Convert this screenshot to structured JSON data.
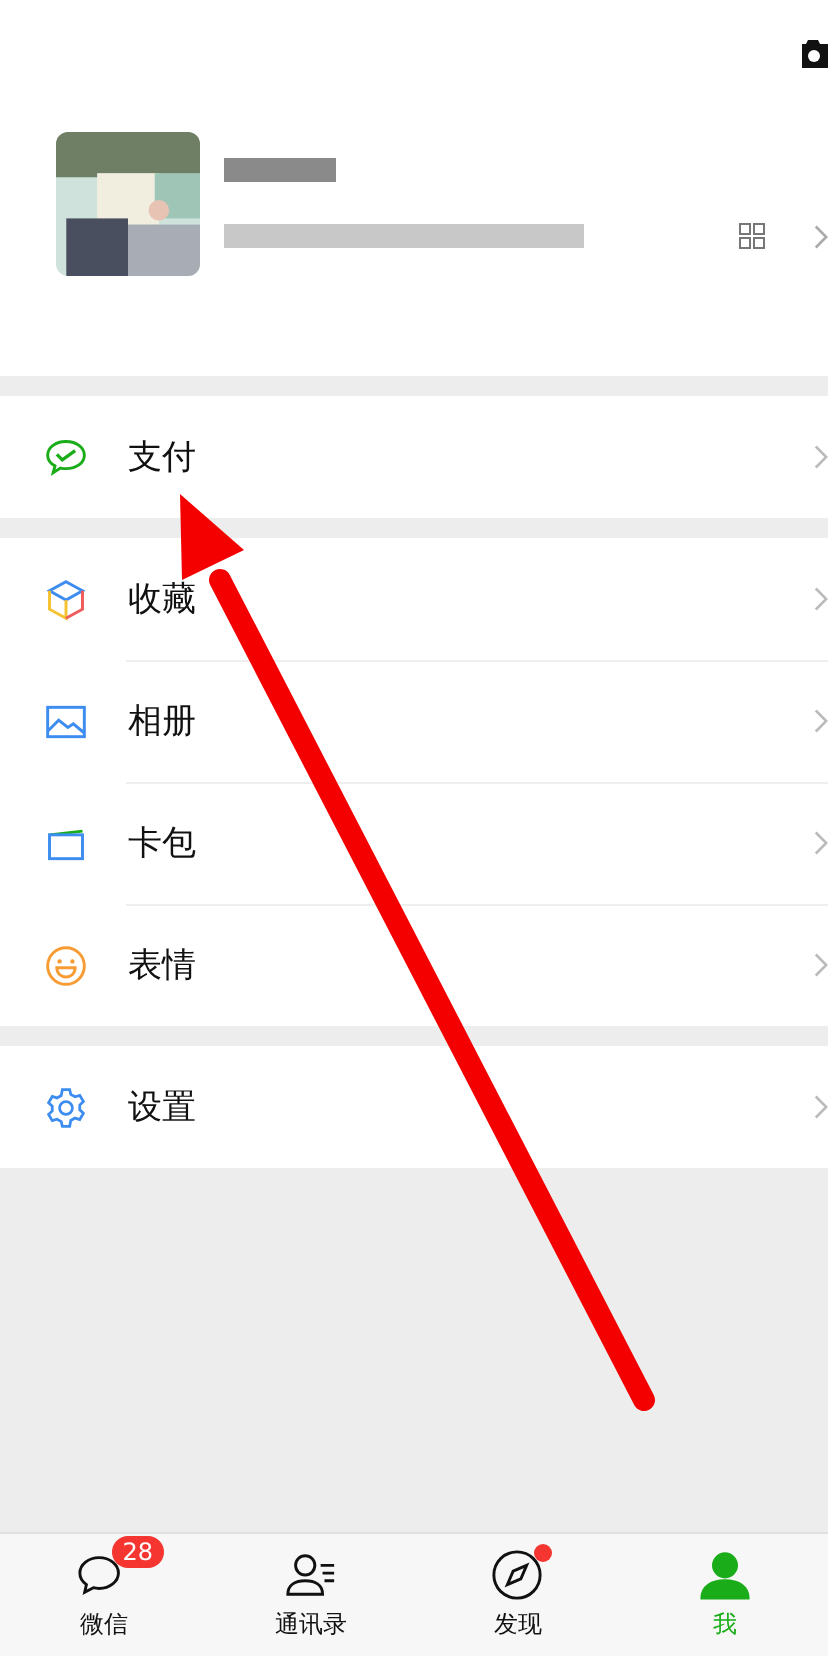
{
  "menu_groups": [
    [
      {
        "label": "支付",
        "kind": "pay"
      }
    ],
    [
      {
        "label": "收藏",
        "kind": "favorites"
      },
      {
        "label": "相册",
        "kind": "album"
      },
      {
        "label": "卡包",
        "kind": "cards"
      },
      {
        "label": "表情",
        "kind": "stickers"
      }
    ],
    [
      {
        "label": "设置",
        "kind": "settings"
      }
    ]
  ],
  "tab_bar": [
    {
      "label": "微信",
      "kind": "chats",
      "selected": false,
      "badge": "28"
    },
    {
      "label": "通讯录",
      "kind": "contacts",
      "selected": false
    },
    {
      "label": "发现",
      "kind": "discover",
      "selected": false,
      "dot": true
    },
    {
      "label": "我",
      "kind": "me",
      "selected": true
    }
  ]
}
